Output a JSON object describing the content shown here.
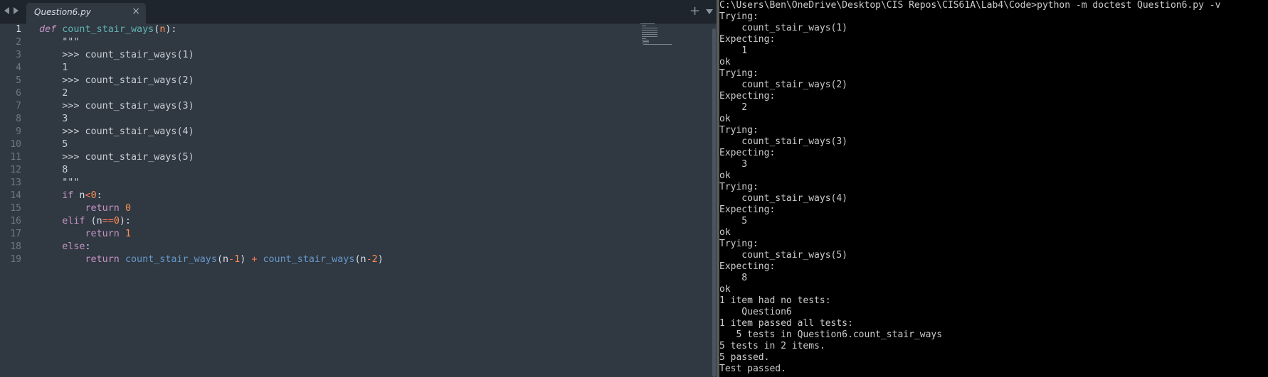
{
  "editor": {
    "tab": {
      "title": "Question6.py",
      "close_glyph": "×"
    },
    "new_tab_glyph": "+",
    "active_line": 1,
    "line_numbers": [
      "1",
      "2",
      "3",
      "4",
      "5",
      "6",
      "7",
      "8",
      "9",
      "10",
      "11",
      "12",
      "13",
      "14",
      "15",
      "16",
      "17",
      "18",
      "19"
    ],
    "code_lines": [
      [
        [
          "kw-def",
          "def"
        ],
        [
          "",
          "",
          " "
        ],
        [
          "fn-def",
          "count_stair_ways"
        ],
        [
          "",
          "("
        ],
        [
          "param",
          "n"
        ],
        [
          "",
          "):"
        ]
      ],
      [
        [
          "str",
          "    \"\"\""
        ]
      ],
      [
        [
          "str",
          "    >>> count_stair_ways(1)"
        ]
      ],
      [
        [
          "str",
          "    1"
        ]
      ],
      [
        [
          "str",
          "    >>> count_stair_ways(2)"
        ]
      ],
      [
        [
          "str",
          "    2"
        ]
      ],
      [
        [
          "str",
          "    >>> count_stair_ways(3)"
        ]
      ],
      [
        [
          "str",
          "    3"
        ]
      ],
      [
        [
          "str",
          "    >>> count_stair_ways(4)"
        ]
      ],
      [
        [
          "str",
          "    5"
        ]
      ],
      [
        [
          "str",
          "    >>> count_stair_ways(5)"
        ]
      ],
      [
        [
          "str",
          "    8"
        ]
      ],
      [
        [
          "str",
          "    \"\"\""
        ]
      ],
      [
        [
          "",
          "    "
        ],
        [
          "kw",
          "if"
        ],
        [
          "",
          " n"
        ],
        [
          "op",
          "<"
        ],
        [
          "num",
          "0"
        ],
        [
          "",
          ":"
        ]
      ],
      [
        [
          "",
          "        "
        ],
        [
          "kw",
          "return"
        ],
        [
          "",
          " "
        ],
        [
          "num",
          "0"
        ]
      ],
      [
        [
          "",
          "    "
        ],
        [
          "kw",
          "elif"
        ],
        [
          "",
          " (n"
        ],
        [
          "op",
          "=="
        ],
        [
          "num",
          "0"
        ],
        [
          "",
          "):"
        ]
      ],
      [
        [
          "",
          "        "
        ],
        [
          "kw",
          "return"
        ],
        [
          "",
          " "
        ],
        [
          "num",
          "1"
        ]
      ],
      [
        [
          "",
          "    "
        ],
        [
          "kw",
          "else"
        ],
        [
          "",
          ":"
        ]
      ],
      [
        [
          "",
          "        "
        ],
        [
          "kw",
          "return"
        ],
        [
          "",
          " "
        ],
        [
          "fn",
          "count_stair_ways"
        ],
        [
          "",
          "(n"
        ],
        [
          "op",
          "-"
        ],
        [
          "num",
          "1"
        ],
        [
          "",
          ") "
        ],
        [
          "op",
          "+"
        ],
        [
          "",
          " "
        ],
        [
          "fn",
          "count_stair_ways"
        ],
        [
          "",
          "(n"
        ],
        [
          "op",
          "-"
        ],
        [
          "num",
          "2"
        ],
        [
          "",
          ")"
        ]
      ]
    ]
  },
  "terminal": {
    "lines": [
      "C:\\Users\\Ben\\OneDrive\\Desktop\\CIS Repos\\CIS61A\\Lab4\\Code>python -m doctest Question6.py -v",
      "Trying:",
      "    count_stair_ways(1)",
      "Expecting:",
      "    1",
      "ok",
      "Trying:",
      "    count_stair_ways(2)",
      "Expecting:",
      "    2",
      "ok",
      "Trying:",
      "    count_stair_ways(3)",
      "Expecting:",
      "    3",
      "ok",
      "Trying:",
      "    count_stair_ways(4)",
      "Expecting:",
      "    5",
      "ok",
      "Trying:",
      "    count_stair_ways(5)",
      "Expecting:",
      "    8",
      "ok",
      "1 item had no tests:",
      "    Question6",
      "1 item passed all tests:",
      "   5 tests in Question6.count_stair_ways",
      "5 tests in 2 items.",
      "5 passed.",
      "Test passed."
    ]
  }
}
